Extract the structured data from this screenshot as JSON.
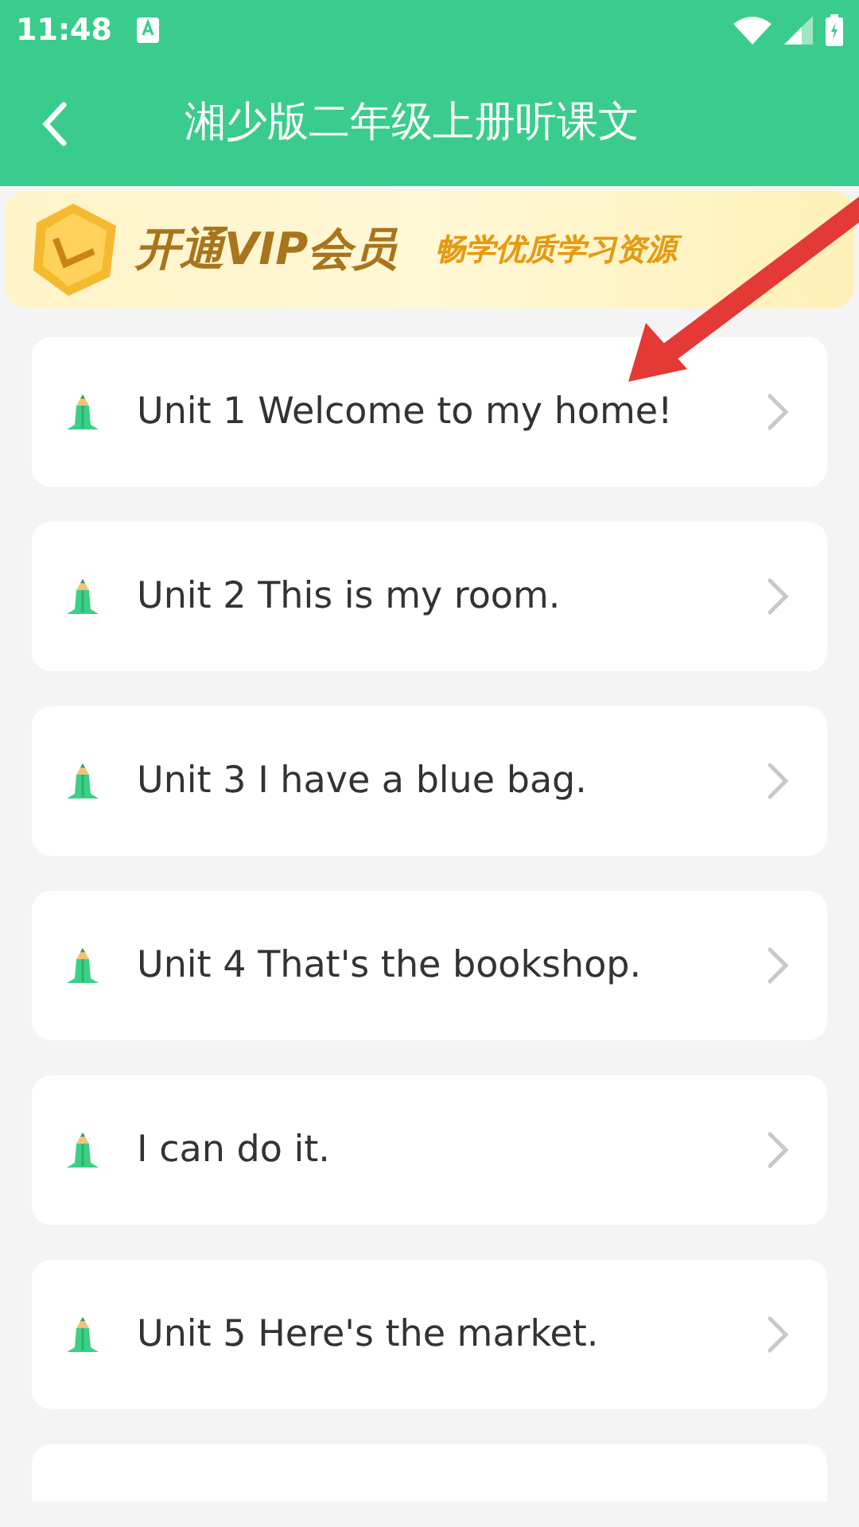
{
  "status_bar": {
    "time": "11:48"
  },
  "app_bar": {
    "title": "湘少版二年级上册听课文"
  },
  "banner": {
    "headline": "开通VIP会员",
    "tagline": "畅学优质学习资源"
  },
  "units": [
    {
      "title": "Unit 1 Welcome to my home!"
    },
    {
      "title": "Unit 2 This is my room."
    },
    {
      "title": "Unit 3 I have a blue bag."
    },
    {
      "title": "Unit 4 That's the bookshop."
    },
    {
      "title": "I can do it."
    },
    {
      "title": "Unit 5 Here's the market."
    }
  ]
}
